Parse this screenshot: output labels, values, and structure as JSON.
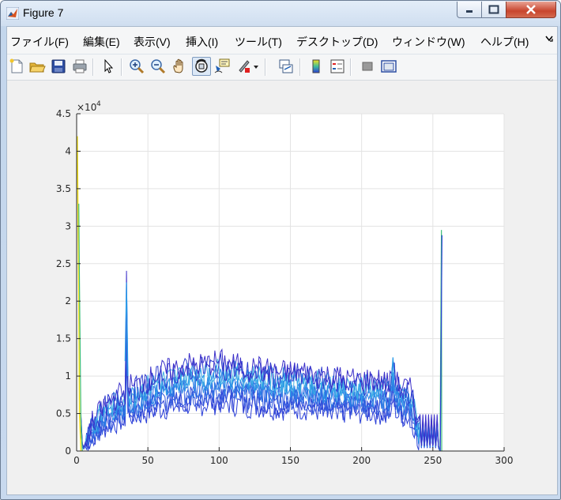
{
  "window": {
    "title": "Figure 7"
  },
  "menu": [
    "ファイル(F)",
    "編集(E)",
    "表示(V)",
    "挿入(I)",
    "ツール(T)",
    "デスクトップ(D)",
    "ウィンドウ(W)",
    "ヘルプ(H)"
  ],
  "menu_overflow_icon": "chevron-overflow-icon",
  "toolbar_icons": [
    "new-figure-icon",
    "open-file-icon",
    "save-icon",
    "print-icon",
    "pointer-icon",
    "zoom-in-icon",
    "zoom-out-icon",
    "pan-hand-icon",
    "rotate-3d-icon",
    "data-cursor-icon",
    "brush-icon",
    "brush-dropdown-icon",
    "link-plot-icon",
    "colorbar-icon",
    "legend-icon",
    "hide-plot-tools-icon",
    "show-plot-tools-icon"
  ],
  "chart_data": {
    "type": "line",
    "title": "",
    "xlabel": "",
    "ylabel": "",
    "xlim": [
      0,
      300
    ],
    "ylim": [
      0,
      45000
    ],
    "x_ticks": [
      "0",
      "50",
      "100",
      "150",
      "200",
      "250",
      "300"
    ],
    "y_ticks": [
      "0",
      "0.5",
      "1",
      "1.5",
      "2",
      "2.5",
      "3",
      "3.5",
      "4",
      "4.5"
    ],
    "y_exponent": "×10",
    "y_exponent_power": "4",
    "grid": true,
    "description_series": "Many overlapping histogram lines (x = 0..255); colors range blue to yellow",
    "series": [
      {
        "values_x": [
          0,
          1,
          2,
          3,
          4,
          5,
          10,
          20,
          30,
          34,
          35,
          36,
          40,
          50,
          60,
          70,
          80,
          90,
          100,
          110,
          120,
          130,
          140,
          150,
          160,
          170,
          180,
          190,
          200,
          210,
          220,
          222,
          225,
          230,
          235,
          240,
          245,
          250,
          255,
          256
        ],
        "values_y": [
          42000,
          30000,
          15000,
          5000,
          1000,
          500,
          3500,
          6000,
          7500,
          8000,
          22500,
          9000,
          8500,
          9500,
          10500,
          11000,
          11500,
          11500,
          12000,
          11500,
          11000,
          11000,
          10500,
          10500,
          10500,
          10000,
          10000,
          9500,
          9500,
          9500,
          9000,
          12500,
          9000,
          8500,
          8000,
          3000,
          2500,
          1500,
          0,
          29000
        ],
        "color": "#0072bd"
      }
    ]
  },
  "colors": {
    "line_blue": "#2b3fd8",
    "line_cyan": "#2b9be8",
    "line_yellow": "#f5e11b",
    "line_green": "#3fbf7a"
  }
}
